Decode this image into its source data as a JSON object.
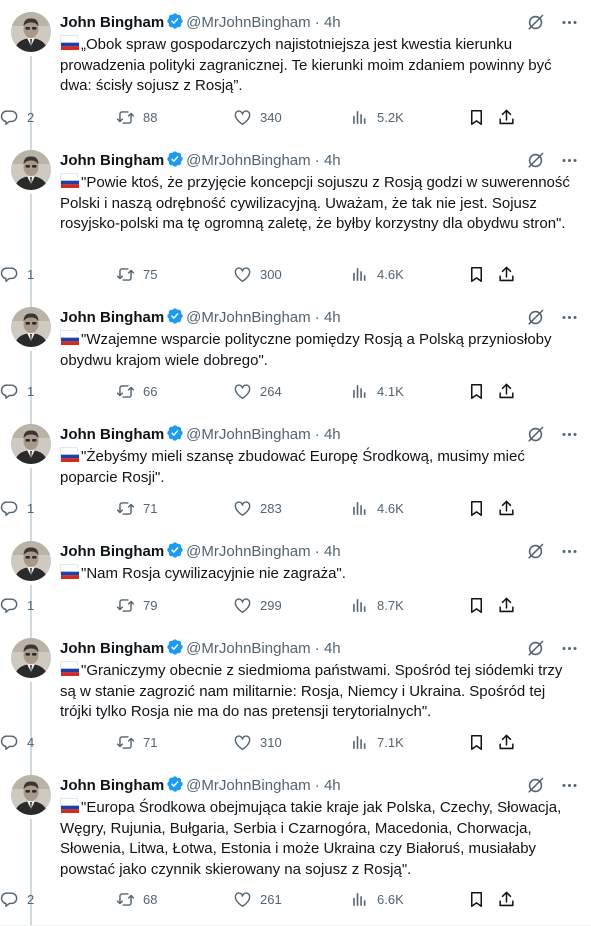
{
  "tweets": [
    {
      "author": "John Bingham",
      "handle": "@MrJohnBingham",
      "time": "4h",
      "text": "„Obok spraw gospodarczych najistotniejsza jest kwestia kierunku prowadzenia polityki zagranicznej. Te kierunki moim zdaniem powinny być dwa: ścisły sojusz z Rosją”.",
      "replies": "2",
      "retweets": "88",
      "likes": "340",
      "views": "5.2K"
    },
    {
      "author": "John Bingham",
      "handle": "@MrJohnBingham",
      "time": "4h",
      "text": "\"Powie ktoś, że przyjęcie koncepcji sojuszu z Rosją godzi w suwerenność Polski i naszą odrębność cywilizacyjną. Uważam, że tak nie jest. Sojusz rosyjsko-polski ma tę ogromną zaletę, że byłby korzystny dla obydwu stron\".",
      "replies": "1",
      "retweets": "75",
      "likes": "300",
      "views": "4.6K"
    },
    {
      "author": "John Bingham",
      "handle": "@MrJohnBingham",
      "time": "4h",
      "text": "\"Wzajemne wsparcie polityczne pomiędzy Rosją a Polską przyniosłoby obydwu krajom wiele dobrego\".",
      "replies": "1",
      "retweets": "66",
      "likes": "264",
      "views": "4.1K"
    },
    {
      "author": "John Bingham",
      "handle": "@MrJohnBingham",
      "time": "4h",
      "text": "\"Żebyśmy mieli szansę zbudować Europę Środkową, musimy mieć poparcie Rosji\".",
      "replies": "1",
      "retweets": "71",
      "likes": "283",
      "views": "4.6K"
    },
    {
      "author": "John Bingham",
      "handle": "@MrJohnBingham",
      "time": "4h",
      "text": "\"Nam Rosja cywilizacyjnie nie zagraża\".",
      "replies": "1",
      "retweets": "79",
      "likes": "299",
      "views": "8.7K"
    },
    {
      "author": "John Bingham",
      "handle": "@MrJohnBingham",
      "time": "4h",
      "text": "\"Graniczymy obecnie z siedmioma państwami. Spośród tej siódemki trzy są w stanie zagrozić nam militarnie: Rosja, Niemcy i Ukraina. Spośród tej trójki tylko Rosja nie ma do nas pretensji terytorialnych\".",
      "replies": "4",
      "retweets": "71",
      "likes": "310",
      "views": "7.1K"
    },
    {
      "author": "John Bingham",
      "handle": "@MrJohnBingham",
      "time": "4h",
      "text": "\"Europa Środkowa obejmująca takie kraje jak Polska, Czechy, Słowacja, Węgry, Rujunia, Bułgaria, Serbia i Czarnogóra, Macedonia, Chorwacja, Słowenia, Litwa, Łotwa, Estonia i może Ukraina czy Białoruś, musiałaby powstać jako czynnik skierowany na sojusz z Rosją\".",
      "replies": "2",
      "retweets": "68",
      "likes": "261",
      "views": "6.6K"
    }
  ],
  "icons": {
    "verified": "verified-badge-icon",
    "grok": "grok-slash-icon",
    "more": "more-dots-icon",
    "flag": "russia-flag-icon",
    "reply": "reply-icon",
    "retweet": "retweet-icon",
    "like": "heart-icon",
    "views": "views-chart-icon",
    "bookmark": "bookmark-icon",
    "share": "share-icon"
  },
  "colors": {
    "text": "#0f1419",
    "secondary": "#536471",
    "verified": "#1d9bf0",
    "thread_line": "#cfd9de"
  }
}
